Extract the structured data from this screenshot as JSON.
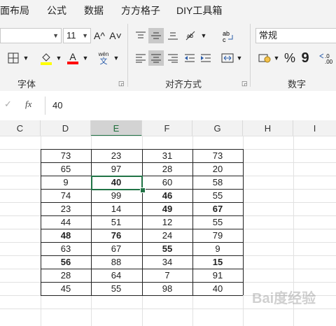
{
  "menu": [
    "面布局",
    "公式",
    "数据",
    "方方格子",
    "DIY工具箱"
  ],
  "ribbon": {
    "font_size": "11",
    "grow_font": "A^",
    "shrink_font": "A˅",
    "phonetic_top": "wén",
    "phonetic_bottom": "文",
    "number_format": "常规",
    "percent": "%",
    "comma": "9",
    "group_font": "字体",
    "group_align": "对齐方式",
    "group_number": "数字",
    "colors": {
      "highlight": "#ffff00",
      "font_color": "#ff0000",
      "accent": "#217346"
    }
  },
  "formula_bar": {
    "fx": "fx",
    "value": "40"
  },
  "columns": [
    "C",
    "D",
    "E",
    "F",
    "G",
    "H",
    "I"
  ],
  "active_column": "E",
  "table": [
    [
      {
        "v": "73",
        "b": false
      },
      {
        "v": "23",
        "b": false
      },
      {
        "v": "31",
        "b": false
      },
      {
        "v": "73",
        "b": false
      }
    ],
    [
      {
        "v": "65",
        "b": false
      },
      {
        "v": "97",
        "b": false
      },
      {
        "v": "28",
        "b": false
      },
      {
        "v": "20",
        "b": false
      }
    ],
    [
      {
        "v": "9",
        "b": false
      },
      {
        "v": "40",
        "b": true
      },
      {
        "v": "60",
        "b": false
      },
      {
        "v": "58",
        "b": false
      }
    ],
    [
      {
        "v": "74",
        "b": false
      },
      {
        "v": "99",
        "b": false
      },
      {
        "v": "46",
        "b": true
      },
      {
        "v": "55",
        "b": false
      }
    ],
    [
      {
        "v": "23",
        "b": false
      },
      {
        "v": "14",
        "b": false
      },
      {
        "v": "49",
        "b": true
      },
      {
        "v": "67",
        "b": true
      }
    ],
    [
      {
        "v": "44",
        "b": false
      },
      {
        "v": "51",
        "b": false
      },
      {
        "v": "12",
        "b": false
      },
      {
        "v": "55",
        "b": false
      }
    ],
    [
      {
        "v": "48",
        "b": true
      },
      {
        "v": "76",
        "b": true
      },
      {
        "v": "24",
        "b": false
      },
      {
        "v": "79",
        "b": false
      }
    ],
    [
      {
        "v": "63",
        "b": false
      },
      {
        "v": "67",
        "b": false
      },
      {
        "v": "55",
        "b": true
      },
      {
        "v": "9",
        "b": false
      }
    ],
    [
      {
        "v": "56",
        "b": true
      },
      {
        "v": "88",
        "b": false
      },
      {
        "v": "34",
        "b": false
      },
      {
        "v": "15",
        "b": true
      }
    ],
    [
      {
        "v": "28",
        "b": false
      },
      {
        "v": "64",
        "b": false
      },
      {
        "v": "7",
        "b": false
      },
      {
        "v": "91",
        "b": false
      }
    ],
    [
      {
        "v": "45",
        "b": false
      },
      {
        "v": "55",
        "b": false
      },
      {
        "v": "98",
        "b": false
      },
      {
        "v": "40",
        "b": false
      }
    ]
  ],
  "watermark": "Bai度经验"
}
